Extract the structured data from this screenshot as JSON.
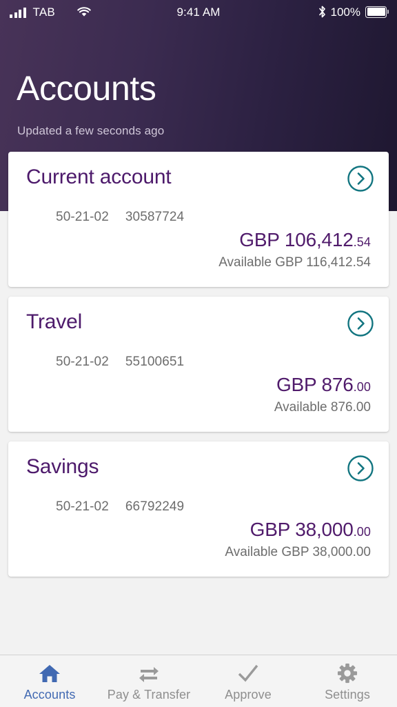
{
  "status_bar": {
    "carrier": "TAB",
    "time": "9:41 AM",
    "battery_percent": "100%",
    "signal_icon": "signal-bars-icon",
    "wifi_icon": "wifi-icon",
    "bluetooth_icon": "bluetooth-icon",
    "battery_icon": "battery-full-icon"
  },
  "header": {
    "title": "Accounts",
    "subtitle": "Updated a few seconds ago",
    "gradient_from": "#483358",
    "gradient_to": "#1e1730"
  },
  "theme": {
    "purple": "#4d1a6b",
    "balance_purple": "#501b6b",
    "teal": "#127580",
    "active_blue": "#4169b2",
    "muted_gray": "#6d6d6d",
    "page_background": "#f2f2f2"
  },
  "accounts": [
    {
      "name": "Current account",
      "sort_code": "50-21-02",
      "account_number": "30587724",
      "balance_main": "GBP 106,412",
      "balance_decimal": ".54",
      "available": "Available GBP 116,412.54",
      "chevron_icon": "chevron-right-circle-icon"
    },
    {
      "name": "Travel",
      "sort_code": "50-21-02",
      "account_number": "55100651",
      "balance_main": "GBP 876",
      "balance_decimal": ".00",
      "available": "Available 876.00",
      "chevron_icon": "chevron-right-circle-icon"
    },
    {
      "name": "Savings",
      "sort_code": "50-21-02",
      "account_number": "66792249",
      "balance_main": "GBP 38,000",
      "balance_decimal": ".00",
      "available": "Available GBP 38,000.00",
      "chevron_icon": "chevron-right-circle-icon"
    }
  ],
  "tabs": [
    {
      "label": "Accounts",
      "icon": "home-icon",
      "active": true
    },
    {
      "label": "Pay & Transfer",
      "icon": "transfer-icon",
      "active": false
    },
    {
      "label": "Approve",
      "icon": "check-icon",
      "active": false
    },
    {
      "label": "Settings",
      "icon": "gear-icon",
      "active": false
    }
  ]
}
